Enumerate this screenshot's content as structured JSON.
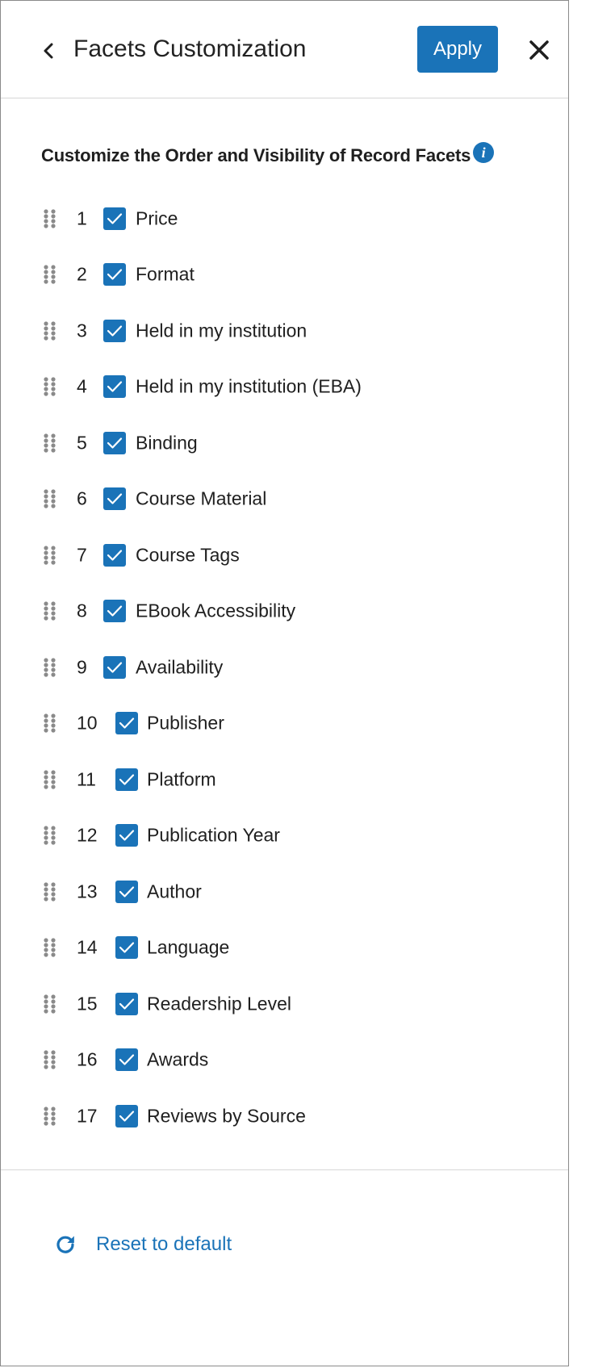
{
  "header": {
    "back_icon": "chevron-left-icon",
    "title": "Facets Customization",
    "apply_label": "Apply",
    "close_icon": "close-icon"
  },
  "section": {
    "heading": "Customize the Order and Visibility of Record Facets",
    "info_icon": "info-icon"
  },
  "facets": [
    {
      "num": "1",
      "label": "Price",
      "checked": true
    },
    {
      "num": "2",
      "label": "Format",
      "checked": true
    },
    {
      "num": "3",
      "label": "Held in my institution",
      "checked": true
    },
    {
      "num": "4",
      "label": "Held in my institution (EBA)",
      "checked": true
    },
    {
      "num": "5",
      "label": "Binding",
      "checked": true
    },
    {
      "num": "6",
      "label": "Course Material",
      "checked": true
    },
    {
      "num": "7",
      "label": "Course Tags",
      "checked": true
    },
    {
      "num": "8",
      "label": "EBook Accessibility",
      "checked": true
    },
    {
      "num": "9",
      "label": "Availability",
      "checked": true
    },
    {
      "num": "10",
      "label": "Publisher",
      "checked": true
    },
    {
      "num": "11",
      "label": "Platform",
      "checked": true
    },
    {
      "num": "12",
      "label": "Publication Year",
      "checked": true
    },
    {
      "num": "13",
      "label": "Author",
      "checked": true
    },
    {
      "num": "14",
      "label": "Language",
      "checked": true
    },
    {
      "num": "15",
      "label": "Readership Level",
      "checked": true
    },
    {
      "num": "16",
      "label": "Awards",
      "checked": true
    },
    {
      "num": "17",
      "label": "Reviews by Source",
      "checked": true
    }
  ],
  "footer": {
    "reset_icon": "refresh-icon",
    "reset_label": "Reset to default"
  },
  "colors": {
    "accent": "#1a73b8",
    "divider": "#d6d6d6"
  }
}
